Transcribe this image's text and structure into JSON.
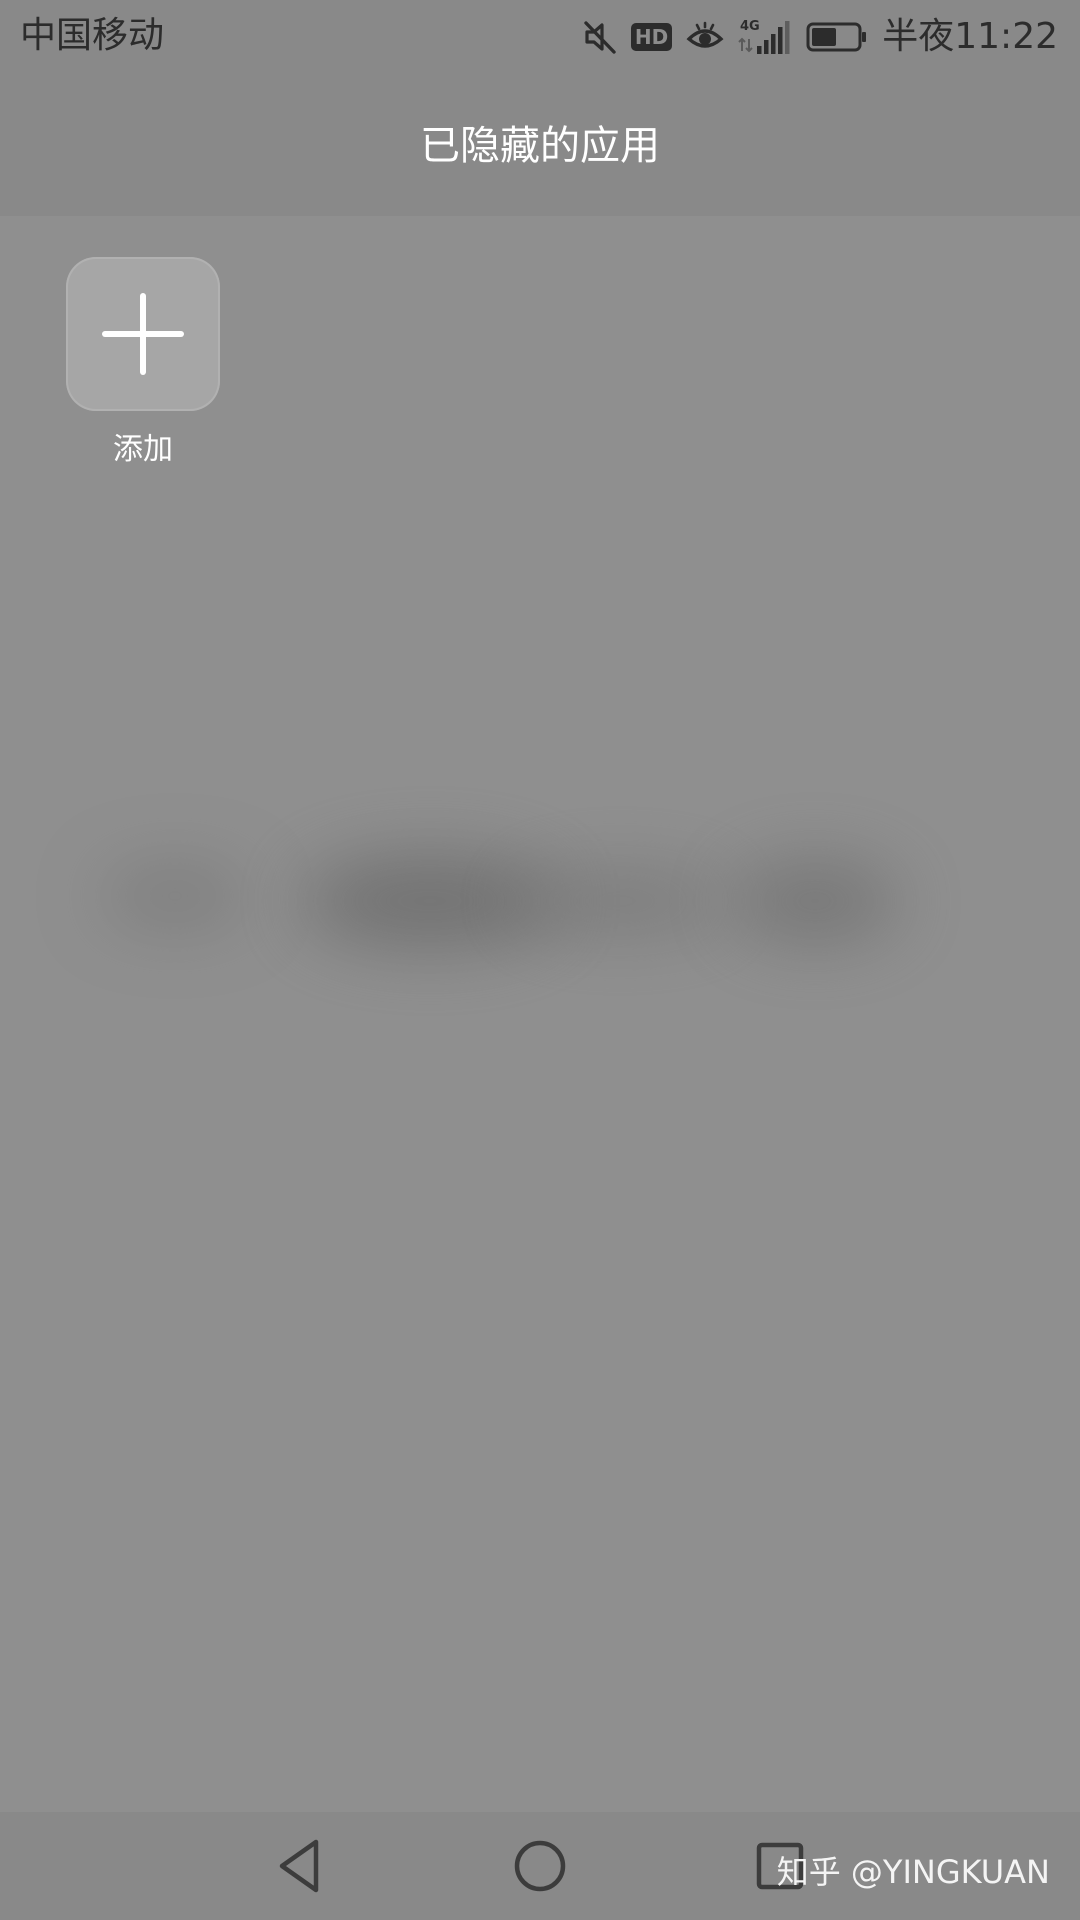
{
  "status_bar": {
    "carrier": "中国移动",
    "network": "4G",
    "hd_badge": "HD",
    "time": "半夜11:22",
    "icons": [
      "mute-icon",
      "hd-icon",
      "eye-icon",
      "signal-4g-icon",
      "battery-icon"
    ],
    "battery_level": 0.55
  },
  "header": {
    "title": "已隐藏的应用"
  },
  "main": {
    "add_tile": {
      "label": "添加",
      "icon": "plus-icon"
    }
  },
  "nav_bar": {
    "buttons": [
      "back-icon",
      "home-icon",
      "recents-icon"
    ]
  },
  "watermark": {
    "text": "知乎 @YINGKUAN"
  },
  "colors": {
    "background": "#8f8f8f",
    "bars": "#898989",
    "tile": "#a6a6a6",
    "text_light": "#ffffff",
    "text_dark": "#2c2c2c"
  }
}
